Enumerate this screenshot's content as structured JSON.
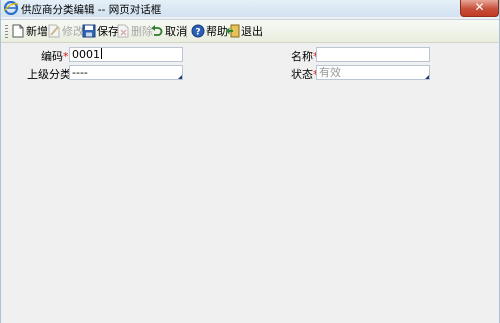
{
  "window": {
    "title": "供应商分类编辑 -- 网页对话框",
    "close_label": "✕"
  },
  "toolbar": {
    "new_label": "新增",
    "edit_label": "修改",
    "save_label": "保存",
    "delete_label": "删除",
    "cancel_label": "取消",
    "help_label": "帮助",
    "exit_label": "退出"
  },
  "form": {
    "code": {
      "label": "编码",
      "required_mark": "*",
      "value": "0001"
    },
    "name": {
      "label": "名称",
      "required_mark": "*",
      "value": ""
    },
    "parent": {
      "label": "上级分类",
      "value": "----"
    },
    "status": {
      "label": "状态",
      "required_mark": "*",
      "value": "有效"
    }
  }
}
